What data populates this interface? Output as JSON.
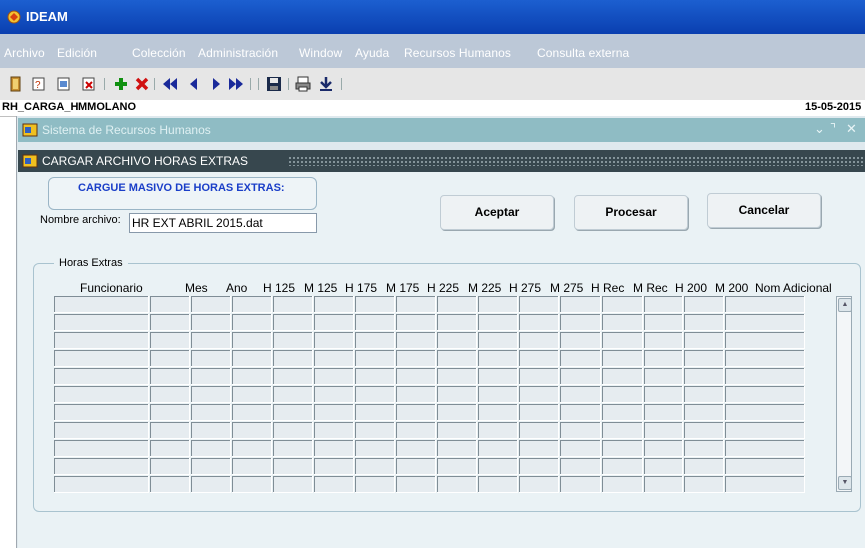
{
  "window": {
    "title": "IDEAM"
  },
  "menu": [
    "Archivo",
    "Edición",
    "Colección",
    "Administración",
    "Window",
    "Ayuda",
    "Recursos Humanos",
    "Consulta externa"
  ],
  "status": {
    "form": "RH_CARGA_H",
    "user": "MMOLANO",
    "date": "15-05-2015"
  },
  "mdi": {
    "title": "Sistema de Recursos Humanos",
    "controls": "⌄ ⌝ ✕"
  },
  "dialog": {
    "title": "CARGAR ARCHIVO HORAS EXTRAS",
    "header": "CARGUE MASIVO DE HORAS EXTRAS:",
    "file_label": "Nombre archivo:",
    "file_value": "HR EXT ABRIL 2015.dat",
    "buttons": {
      "accept": "Aceptar",
      "process": "Procesar",
      "cancel": "Cancelar"
    },
    "group_label": "Horas Extras",
    "columns": [
      "Funcionario",
      "Mes",
      "Ano",
      "H 125",
      "M 125",
      "H 175",
      "M 175",
      "H 225",
      "M 225",
      "H 275",
      "M 275",
      "H Rec",
      "M Rec",
      "H 200",
      "M 200",
      "Nom Adicional"
    ],
    "row_count": 11
  },
  "colors": {
    "titlebar": "#0a3fb0",
    "menubar": "#bcc8d7",
    "header_text": "#1a3ec8",
    "dialog_bar": "#37474e",
    "mdi_bar": "#8fbcc4"
  },
  "icons": [
    "exit-icon",
    "query-icon",
    "execute-query-icon",
    "cancel-query-icon",
    "insert-record-icon",
    "delete-record-icon",
    "first-record-icon",
    "previous-record-icon",
    "next-record-icon",
    "last-record-icon",
    "save-icon",
    "print-icon",
    "download-icon"
  ]
}
